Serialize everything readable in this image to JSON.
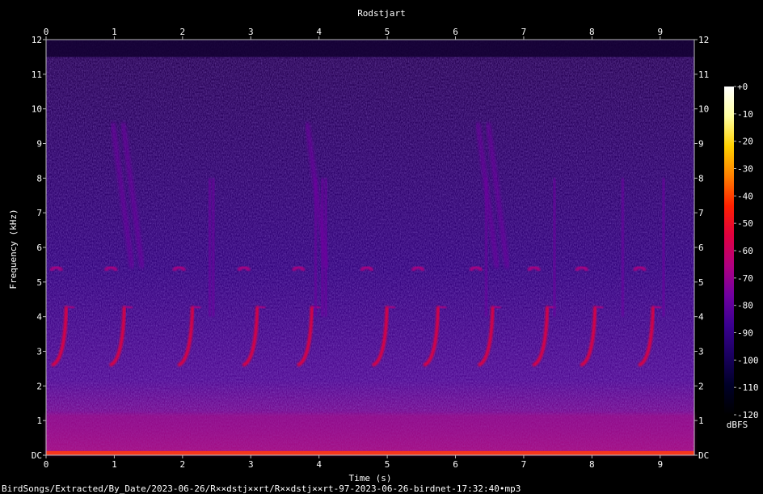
{
  "chart_data": {
    "type": "heatmap",
    "title": "Rodstjart",
    "xlabel": "Time (s)",
    "ylabel": "Frequency (kHz)",
    "xlim": [
      0,
      9.5
    ],
    "ylim": [
      0,
      12
    ],
    "x_ticks": [
      "0",
      "1",
      "2",
      "3",
      "4",
      "5",
      "6",
      "7",
      "8",
      "9"
    ],
    "y_ticks": [
      "DC",
      "1",
      "2",
      "3",
      "4",
      "5",
      "6",
      "7",
      "8",
      "9",
      "10",
      "11",
      "12"
    ],
    "colorbar": {
      "label": "dBFS",
      "range": [
        -120,
        0
      ],
      "ticks": [
        "+0",
        "-10",
        "-20",
        "-30",
        "-40",
        "-50",
        "-60",
        "-70",
        "-80",
        "-90",
        "-100",
        "-110",
        "-120"
      ],
      "colors": [
        "#ffffff",
        "#ffffa0",
        "#ffd000",
        "#ff8000",
        "#ff2000",
        "#e00040",
        "#b00080",
        "#7000a0",
        "#3a0090",
        "#1a0060",
        "#000028",
        "#000000"
      ]
    },
    "spectral_content": {
      "noise_floor_dbfs": -95,
      "signal_max_khz": 11.5,
      "low_band_khz": [
        0,
        1.2
      ],
      "song_elements": [
        {
          "kind": "upsweep",
          "times": [
            0.25,
            1.1,
            2.1,
            3.05,
            3.85,
            4.95,
            5.7,
            6.5,
            7.3,
            8.0,
            8.85
          ],
          "f_low_khz": 2.6,
          "f_high_khz": 4.3,
          "level_dbfs": -55
        },
        {
          "kind": "chip",
          "times": [
            0.15,
            0.95,
            1.95,
            2.9,
            3.7,
            4.7,
            5.45,
            6.3,
            7.15,
            7.85,
            8.7
          ],
          "freq_khz": 5.4,
          "level_dbfs": -70
        },
        {
          "kind": "downsweep",
          "times": [
            1.0,
            1.15,
            3.85,
            6.35,
            6.5
          ],
          "f_high_khz": 9.6,
          "f_low_khz": 5.4,
          "level_dbfs": -78
        },
        {
          "kind": "click",
          "times": [
            2.4,
            2.45,
            3.95,
            4.05,
            4.1,
            6.45,
            7.45,
            8.45,
            9.05
          ],
          "f_low_khz": 4.0,
          "f_high_khz": 8.0,
          "level_dbfs": -80
        }
      ]
    }
  },
  "footer": {
    "path": "BirdSongs/Extracted/By_Date/2023-06-26/R××dstj××rt/R××dstj××rt-97-2023-06-26-birdnet-17:32:40•mp3"
  }
}
